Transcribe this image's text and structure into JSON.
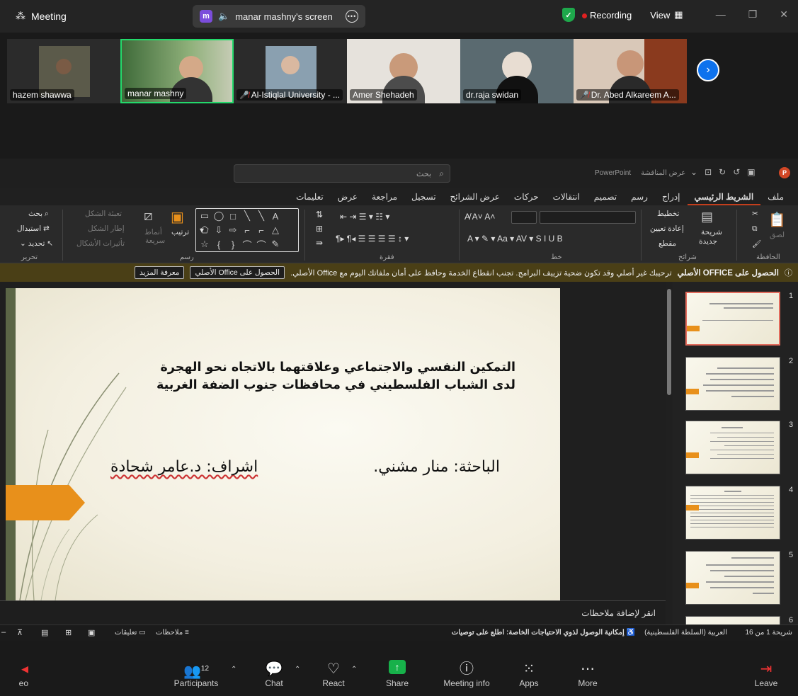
{
  "zoom": {
    "window_title": "Meeting",
    "share_pill": {
      "initial": "m",
      "label": "manar mashny's screen"
    },
    "recording_label": "Recording",
    "view_label": "View",
    "participants": [
      {
        "name": "hazem shawwa",
        "muted": false
      },
      {
        "name": "manar mashny",
        "muted": false,
        "active": true
      },
      {
        "name": "Al-Istiqlal University - ...",
        "muted": true
      },
      {
        "name": "Amer Shehadeh",
        "muted": false
      },
      {
        "name": "dr.raja swidan",
        "muted": false
      },
      {
        "name": "Dr. Abed Alkareem A...",
        "muted": true
      }
    ],
    "toolbar": {
      "video_label": "eo",
      "participants_label": "Participants",
      "participants_count": "12",
      "chat_label": "Chat",
      "react_label": "React",
      "share_label": "Share",
      "meeting_info_label": "Meeting info",
      "apps_label": "Apps",
      "more_label": "More",
      "leave_label": "Leave"
    }
  },
  "powerpoint": {
    "search_placeholder": "بحث",
    "app_name": "PowerPoint",
    "doc_name": "عرض المناقشة",
    "tabs": [
      "ملف",
      "الشريط الرئيسي",
      "إدراج",
      "رسم",
      "تصميم",
      "انتقالات",
      "حركات",
      "عرض الشرائح",
      "تسجيل",
      "مراجعة",
      "عرض",
      "تعليمات"
    ],
    "active_tab": "الشريط الرئيسي",
    "ribbon": {
      "clipboard_label": "الحافظة",
      "paste": "لصق",
      "slides_label": "شرائح",
      "new_slide": "شريحة",
      "new_slide2": "جديدة",
      "layout": "تخطيط",
      "reset": "إعادة تعيين",
      "section": "مقطع",
      "font_label": "خط",
      "paragraph_label": "فقرة",
      "drawing_label": "رسم",
      "arrange": "ترتيب",
      "quick_styles": "أنماط",
      "quick_styles2": "سريعة",
      "shape_fill": "تعبئة الشكل",
      "shape_outline": "إطار الشكل",
      "shape_effects": "تأثيرات الأشكال",
      "editing_label": "تحرير",
      "find": "بحث",
      "replace": "استبدال",
      "select": "تحديد"
    },
    "office_bar": {
      "title": "الحصول على OFFICE الأصلي",
      "message": "ترحيبك غير أصلي وقد تكون ضحية تزييف البرامج. تجنب انقطاع الخدمة وحافظ على أمان ملفاتك اليوم مع Office الأصلي.",
      "button1": "الحصول على Office الأصلي",
      "button2": "معرفة المزيد"
    },
    "slide": {
      "title": "التمكين النفسي والاجتماعي وعلاقتهما بالاتجاه نحو الهجرة لدى الشباب الفلسطيني في محافظات جنوب الضفة الغربية",
      "researcher": "الباحثة: منار مشني.",
      "supervisor": "اشراف: د.عامر شحادة"
    },
    "notes_placeholder": "انقر لإضافة ملاحظات",
    "thumb_numbers": [
      "1",
      "2",
      "3",
      "4",
      "5",
      "6"
    ],
    "status": {
      "slide_info": "شريحة 1 من 16",
      "language": "العربية (السلطة الفلسطينية)",
      "accessibility": "إمكانية الوصول لذوي الاحتياجات الخاصة: اطلع على توصيات",
      "notes": "ملاحظات",
      "comments": "تعليقات"
    }
  },
  "colors": {
    "accent_orange": "#e8901b",
    "slide_band": "#5b6646",
    "zoom_share_green": "#17b14a",
    "recording_red": "#e02020"
  }
}
